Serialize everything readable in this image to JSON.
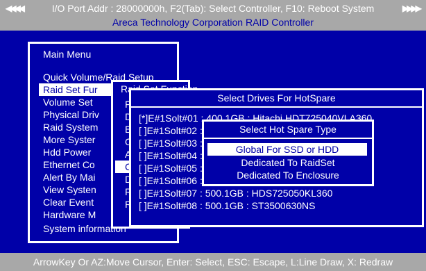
{
  "header": {
    "line1": "I/O Port Addr : 28000000h, F2(Tab): Select Controller, F10: Reboot System",
    "line2": "Areca Technology Corporation RAID Controller",
    "arrow_left": "◀◀◀◀",
    "arrow_right": "▶▶▶▶"
  },
  "main_menu": {
    "title": "Main Menu",
    "items": [
      "Quick Volume/Raid Setup",
      "Raid Set Fur",
      "Volume Set",
      "Physical Driv",
      "Raid System",
      "More Syster",
      "Hdd Power",
      "Ethernet Co",
      "Alert By Mai",
      "View Systen",
      "Clear Event",
      "Hardware M",
      "System information"
    ],
    "selected_index": 1
  },
  "raid_set_function": {
    "title": "Raid Set Function",
    "items": [
      "C",
      "D",
      "E",
      "O",
      "A",
      "C",
      "D",
      "R",
      "R"
    ],
    "item0": "F",
    "selected_index": 5
  },
  "select_drives": {
    "title": "Select Drives For HotSpare",
    "drives": [
      "[*]E#1Solt#01 : 400.1GB : Hitachi HDT725040VLA360",
      "[ ]E#1Solt#02 : 400.1GB : Hitachi HDT725040VLA360",
      "[ ]E#1Solt#03 : 400.1GB : Hitachi HDT725040VLA360",
      "[ ]E#1Solt#04 : 400.1GB : Hitachi HDT725040VLA360",
      "[ ]E#1Solt#05 : 400.1GB : Hitachi HDT725040VLA360",
      "[ ]E#1Solt#06 : 400.1GB : Hitachi HDT725040VLA360",
      "[ ]E#1Solt#07 : 500.1GB : HDS725050KL360",
      "[ ]E#1Solt#08 : 500.1GB : ST3500630NS"
    ],
    "selected_index": 0
  },
  "hot_spare_type": {
    "title": "Select Hot Spare Type",
    "items": [
      "Global For SSD or HDD",
      "Dedicated To RaidSet",
      "Dedicated To Enclosure"
    ],
    "selected_index": 0
  },
  "footer": {
    "text": "ArrowKey Or AZ:Move Cursor, Enter: Select, ESC: Escape, L:Line Draw, X: Redraw"
  },
  "colors": {
    "background": "#0000a8",
    "bar": "#a8a8a8",
    "highlight": "#ffffff",
    "text": "#ffffff"
  }
}
